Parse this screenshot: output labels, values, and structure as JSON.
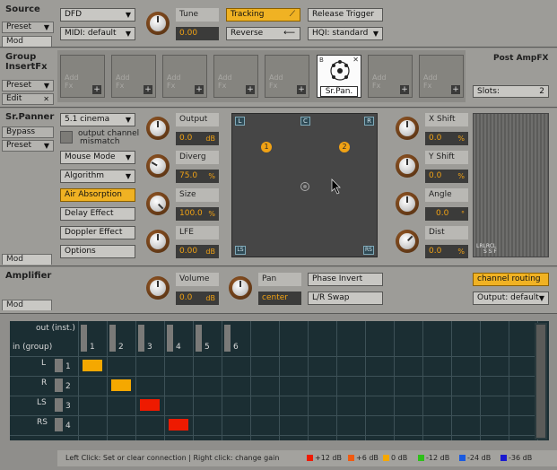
{
  "source": {
    "label": "Source",
    "preset": "Preset",
    "mod": "Mod",
    "mode_dropdown": "DFD",
    "midi_dropdown": "MIDI: default",
    "tune_label": "Tune",
    "tune_value": "0.00",
    "tracking": "Tracking",
    "reverse": "Reverse",
    "release_trigger": "Release Trigger",
    "hqi_dropdown": "HQI: standard"
  },
  "group_insert_fx": {
    "label_line1": "Group",
    "label_line2": "InsertFx",
    "preset": "Preset",
    "edit": "Edit",
    "slot_text_line1": "Add",
    "slot_text_line2": "Fx",
    "plus": "+",
    "panner_slot_label": "Sr.Pan.",
    "post_amp_label": "Post AmpFX",
    "slots_label": "Slots:",
    "slots_value": "2"
  },
  "panner": {
    "label": "Sr.Panner",
    "bypass": "Bypass",
    "preset": "Preset",
    "mod": "Mod",
    "format_dropdown": "5.1 cinema",
    "output_mismatch_line1": "output channel",
    "output_mismatch_line2": "mismatch",
    "mouse_mode": "Mouse Mode",
    "algorithm": "Algorithm",
    "air_absorption": "Air Absorption",
    "delay_effect": "Delay Effect",
    "doppler_effect": "Doppler Effect",
    "options": "Options",
    "output_label": "Output",
    "output_value": "0.0",
    "output_unit": "dB",
    "diverg_label": "Diverg",
    "diverg_value": "75.0",
    "diverg_unit": "%",
    "size_label": "Size",
    "size_value": "100.0",
    "size_unit": "%",
    "lfe_label": "LFE",
    "lfe_value": "0.00",
    "lfe_unit": "dB",
    "speaker_L": "L",
    "speaker_C": "C",
    "speaker_R": "R",
    "speaker_LS": "LS",
    "speaker_RS": "RS",
    "source_1": "1",
    "source_2": "2",
    "xshift_label": "X Shift",
    "xshift_value": "0.0",
    "xshift_unit": "%",
    "yshift_label": "Y Shift",
    "yshift_value": "0.0",
    "yshift_unit": "%",
    "angle_label": "Angle",
    "angle_value": "0.0",
    "angle_unit": "°",
    "dist_label": "Dist",
    "dist_value": "0.0",
    "dist_unit": "%",
    "meter_labels_line1": "LRLRCL",
    "meter_labels_line2": "S S F"
  },
  "amplifier": {
    "label": "Amplifier",
    "mod": "Mod",
    "volume_label": "Volume",
    "volume_value": "0.0",
    "volume_unit": "dB",
    "pan_label": "Pan",
    "pan_value": "center",
    "phase_invert": "Phase Invert",
    "lr_swap": "L/R Swap",
    "channel_routing": "channel routing",
    "output_dropdown": "Output: default"
  },
  "routing": {
    "out_label": "out (inst.)",
    "in_label": "in (group)",
    "columns": [
      "1",
      "2",
      "3",
      "4",
      "5",
      "6"
    ],
    "rows": [
      {
        "name": "L",
        "num": "1"
      },
      {
        "name": "R",
        "num": "2"
      },
      {
        "name": "LS",
        "num": "3"
      },
      {
        "name": "RS",
        "num": "4"
      }
    ],
    "connections": [
      {
        "row": 0,
        "col": 0,
        "color": "#f5a800"
      },
      {
        "row": 1,
        "col": 1,
        "color": "#f5a800"
      },
      {
        "row": 2,
        "col": 2,
        "color": "#ee1a00"
      },
      {
        "row": 3,
        "col": 3,
        "color": "#ee1a00"
      }
    ]
  },
  "status": {
    "help": "Left Click: Set or clear connection | Right click: change gain",
    "legend": [
      {
        "label": "+12 dB",
        "color": "#ee1a00"
      },
      {
        "label": "+6 dB",
        "color": "#f05a10"
      },
      {
        "label": "0 dB",
        "color": "#f5a800"
      },
      {
        "label": "-12 dB",
        "color": "#2ec01a"
      },
      {
        "label": "-24 dB",
        "color": "#1a5ae0"
      },
      {
        "label": "-36 dB",
        "color": "#1a1ad0"
      }
    ]
  }
}
